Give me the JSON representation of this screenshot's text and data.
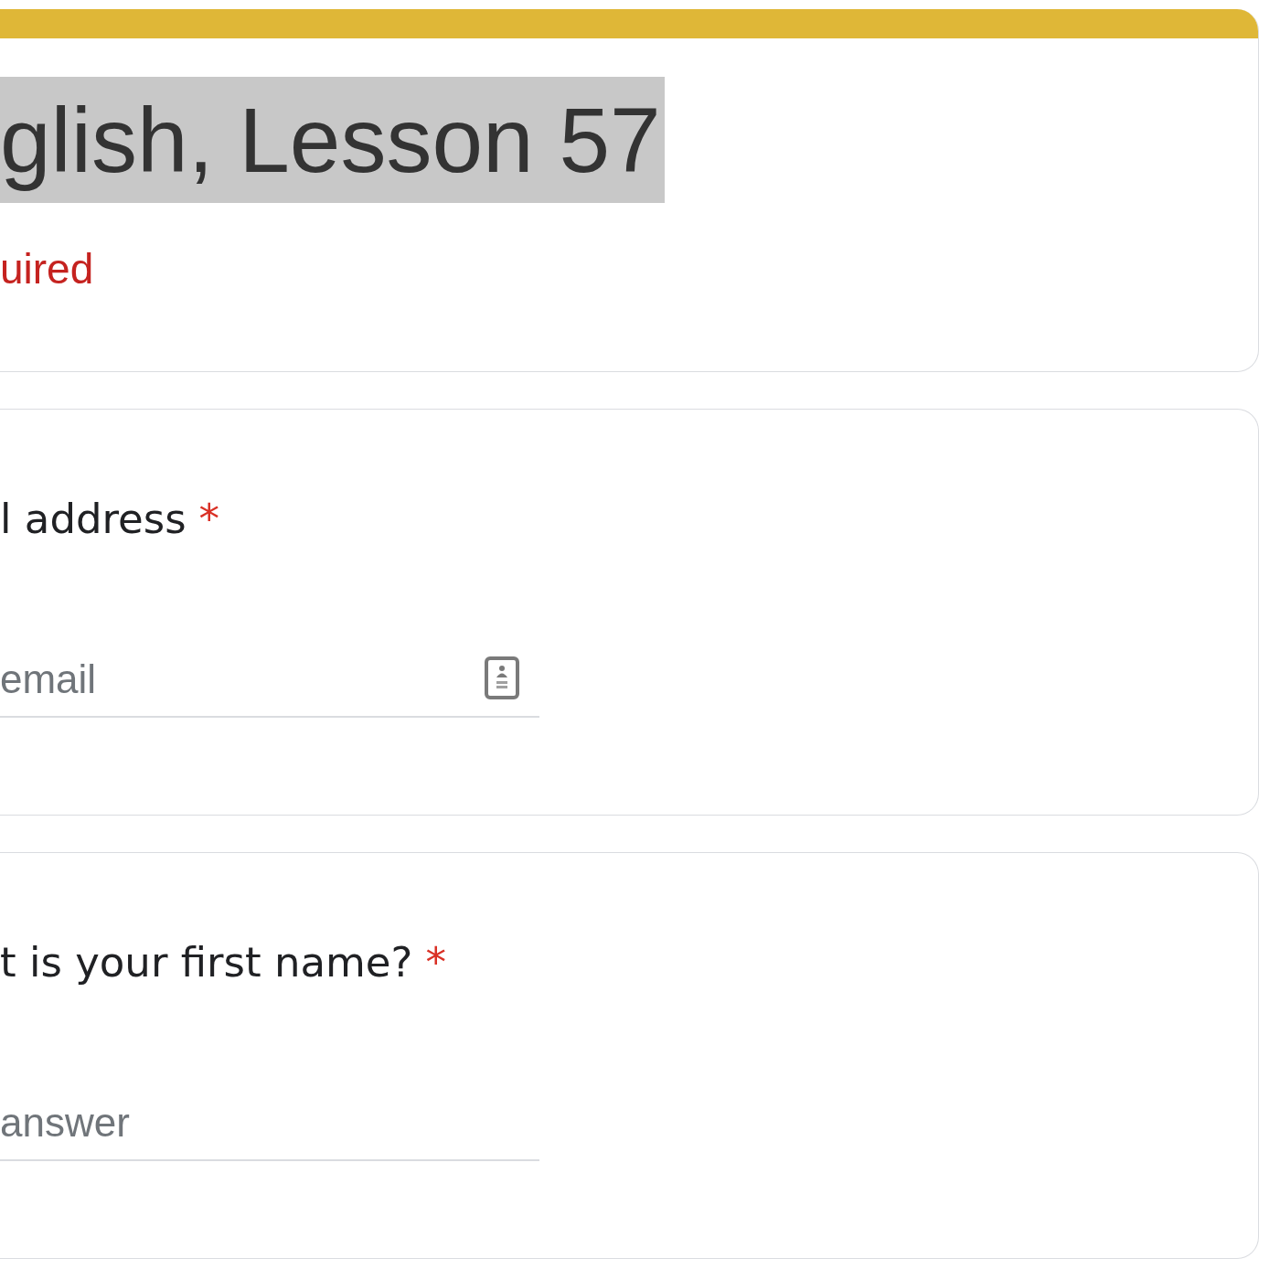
{
  "form_header": {
    "title": "glish, Lesson 57",
    "title_highlighted": true,
    "required_note": "uired"
  },
  "questions": [
    {
      "label": "l address",
      "required_mark": "*",
      "field": {
        "kind": "email",
        "placeholder": "email"
      }
    },
    {
      "label": "t is your first name?",
      "required_mark": "*",
      "field": {
        "kind": "text",
        "placeholder": "answer"
      }
    }
  ]
}
